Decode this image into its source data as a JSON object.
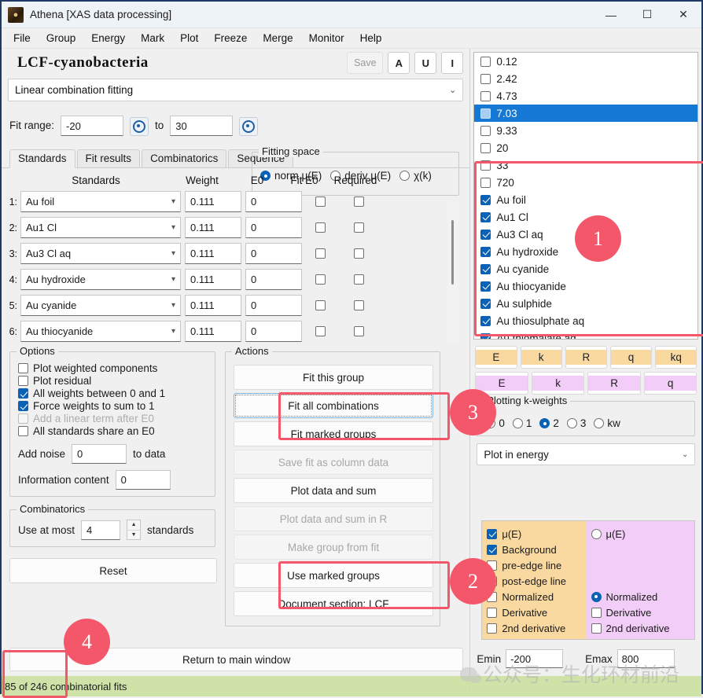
{
  "window": {
    "title": "Athena [XAS data processing]",
    "icon": "athena-app-icon",
    "minimize": "—",
    "maximize": "☐",
    "close": "✕"
  },
  "menubar": [
    "File",
    "Group",
    "Energy",
    "Mark",
    "Plot",
    "Freeze",
    "Merge",
    "Monitor",
    "Help"
  ],
  "group_header": {
    "name": "LCF-cyanobacteria",
    "save_label": "Save",
    "buttons": [
      "A",
      "U",
      "I"
    ]
  },
  "module_select": {
    "value": "Linear combination fitting",
    "chevron": "⌄"
  },
  "fit_range": {
    "label": "Fit range:",
    "min": "-20",
    "to": "to",
    "max": "30",
    "pick_icon": "crosshair-icon"
  },
  "fitting_space": {
    "legend": "Fitting space",
    "options": [
      {
        "label": "norm μ(E)",
        "selected": true
      },
      {
        "label": "deriv μ(E)",
        "selected": false
      },
      {
        "label": "χ(k)",
        "selected": false
      }
    ]
  },
  "tabs": [
    {
      "label": "Standards",
      "active": true
    },
    {
      "label": "Fit results",
      "active": false
    },
    {
      "label": "Combinatorics",
      "active": false
    },
    {
      "label": "Sequence",
      "active": false
    }
  ],
  "standards_table": {
    "headers": [
      "Standards",
      "Weight",
      "E0",
      "Fit E0",
      "Required"
    ],
    "rows": [
      {
        "index": "1:",
        "standard": "Au foil",
        "weight": "0.111",
        "e0": "0",
        "fit_e0": false,
        "required": false
      },
      {
        "index": "2:",
        "standard": "Au1 Cl",
        "weight": "0.111",
        "e0": "0",
        "fit_e0": false,
        "required": false
      },
      {
        "index": "3:",
        "standard": "Au3 Cl aq",
        "weight": "0.111",
        "e0": "0",
        "fit_e0": false,
        "required": false
      },
      {
        "index": "4:",
        "standard": "Au hydroxide",
        "weight": "0.111",
        "e0": "0",
        "fit_e0": false,
        "required": false
      },
      {
        "index": "5:",
        "standard": "Au cyanide",
        "weight": "0.111",
        "e0": "0",
        "fit_e0": false,
        "required": false
      },
      {
        "index": "6:",
        "standard": "Au thiocyanide",
        "weight": "0.111",
        "e0": "0",
        "fit_e0": false,
        "required": false
      }
    ]
  },
  "options": {
    "legend": "Options",
    "items": [
      {
        "label": "Plot weighted components",
        "checked": false,
        "disabled": false
      },
      {
        "label": "Plot residual",
        "checked": false,
        "disabled": false
      },
      {
        "label": "All weights between 0 and 1",
        "checked": true,
        "disabled": false
      },
      {
        "label": "Force weights to sum to 1",
        "checked": true,
        "disabled": false
      },
      {
        "label": "Add a linear term after E0",
        "checked": false,
        "disabled": true
      },
      {
        "label": "All standards share an E0",
        "checked": false,
        "disabled": false
      }
    ],
    "noise_label": "Add noise",
    "noise_value": "0",
    "noise_suffix": "to data",
    "info_label": "Information content",
    "info_value": "0"
  },
  "combinatorics": {
    "legend": "Combinatorics",
    "prefix": "Use at most",
    "value": "4",
    "suffix": "standards"
  },
  "reset_button": "Reset",
  "actions": {
    "legend": "Actions",
    "buttons": [
      {
        "label": "Fit this group",
        "disabled": false,
        "focus": false
      },
      {
        "label": "Fit all combinations",
        "disabled": false,
        "focus": true
      },
      {
        "label": "Fit marked groups",
        "disabled": false,
        "focus": false
      },
      {
        "label": "Save fit as column data",
        "disabled": true,
        "focus": false
      },
      {
        "label": "Plot data and sum",
        "disabled": false,
        "focus": false
      },
      {
        "label": "Plot data and sum in R",
        "disabled": true,
        "focus": false
      },
      {
        "label": "Make group from fit",
        "disabled": true,
        "focus": false
      },
      {
        "label": "Use marked groups",
        "disabled": false,
        "focus": false
      },
      {
        "label": "Document section: LCF",
        "disabled": false,
        "focus": false
      }
    ]
  },
  "return_button": "Return to main window",
  "status_bar": "85 of 246 combinatorial fits",
  "group_list": [
    {
      "label": "0.12",
      "checked": false,
      "selected": false
    },
    {
      "label": "2.42",
      "checked": false,
      "selected": false
    },
    {
      "label": "4.73",
      "checked": false,
      "selected": false
    },
    {
      "label": "7.03",
      "checked": false,
      "selected": true
    },
    {
      "label": "9.33",
      "checked": false,
      "selected": false
    },
    {
      "label": "20",
      "checked": false,
      "selected": false
    },
    {
      "label": "33",
      "checked": false,
      "selected": false
    },
    {
      "label": "720",
      "checked": false,
      "selected": false
    },
    {
      "label": "Au foil",
      "checked": true,
      "selected": false
    },
    {
      "label": "Au1 Cl",
      "checked": true,
      "selected": false
    },
    {
      "label": "Au3 Cl aq",
      "checked": true,
      "selected": false
    },
    {
      "label": "Au hydroxide",
      "checked": true,
      "selected": false
    },
    {
      "label": "Au cyanide",
      "checked": true,
      "selected": false
    },
    {
      "label": "Au thiocyanide",
      "checked": true,
      "selected": false
    },
    {
      "label": "Au sulphide",
      "checked": true,
      "selected": false
    },
    {
      "label": "Au thiosulphate aq",
      "checked": true,
      "selected": false
    },
    {
      "label": "Au thiomalate aq",
      "checked": true,
      "selected": false
    }
  ],
  "plot_buttons_orange": [
    "E",
    "k",
    "R",
    "q",
    "kq"
  ],
  "plot_buttons_violet": [
    "E",
    "k",
    "R",
    "q"
  ],
  "k_weights": {
    "legend": "Plotting k-weights",
    "options": [
      {
        "label": "0",
        "selected": false
      },
      {
        "label": "1",
        "selected": false
      },
      {
        "label": "2",
        "selected": true
      },
      {
        "label": "3",
        "selected": false
      },
      {
        "label": "kw",
        "selected": false
      }
    ]
  },
  "plot_mode": {
    "value": "Plot in energy",
    "chevron": "⌄"
  },
  "plot_options": {
    "orange": [
      {
        "label": "μ(E)",
        "checked": true
      },
      {
        "label": "Background",
        "checked": true
      },
      {
        "label": "pre-edge line",
        "checked": false
      },
      {
        "label": "post-edge line",
        "checked": false
      },
      {
        "label": "Normalized",
        "checked": false
      },
      {
        "label": "Derivative",
        "checked": false
      },
      {
        "label": "2nd derivative",
        "checked": false
      }
    ],
    "violet": [
      {
        "label": "μ(E)",
        "type": "radio",
        "checked": false
      },
      {
        "label": "Normalized",
        "type": "radio",
        "checked": true
      },
      {
        "label": "Derivative",
        "type": "checkbox",
        "checked": false
      },
      {
        "label": "2nd derivative",
        "type": "checkbox",
        "checked": false
      }
    ]
  },
  "energy_range": {
    "emin_label": "Emin",
    "emin_value": "-200",
    "emax_label": "Emax",
    "emax_value": "800"
  },
  "annotations": {
    "markers": [
      "1",
      "2",
      "3",
      "4"
    ],
    "color": "#f4566a"
  },
  "watermark": "公众号：生化环材前沿"
}
